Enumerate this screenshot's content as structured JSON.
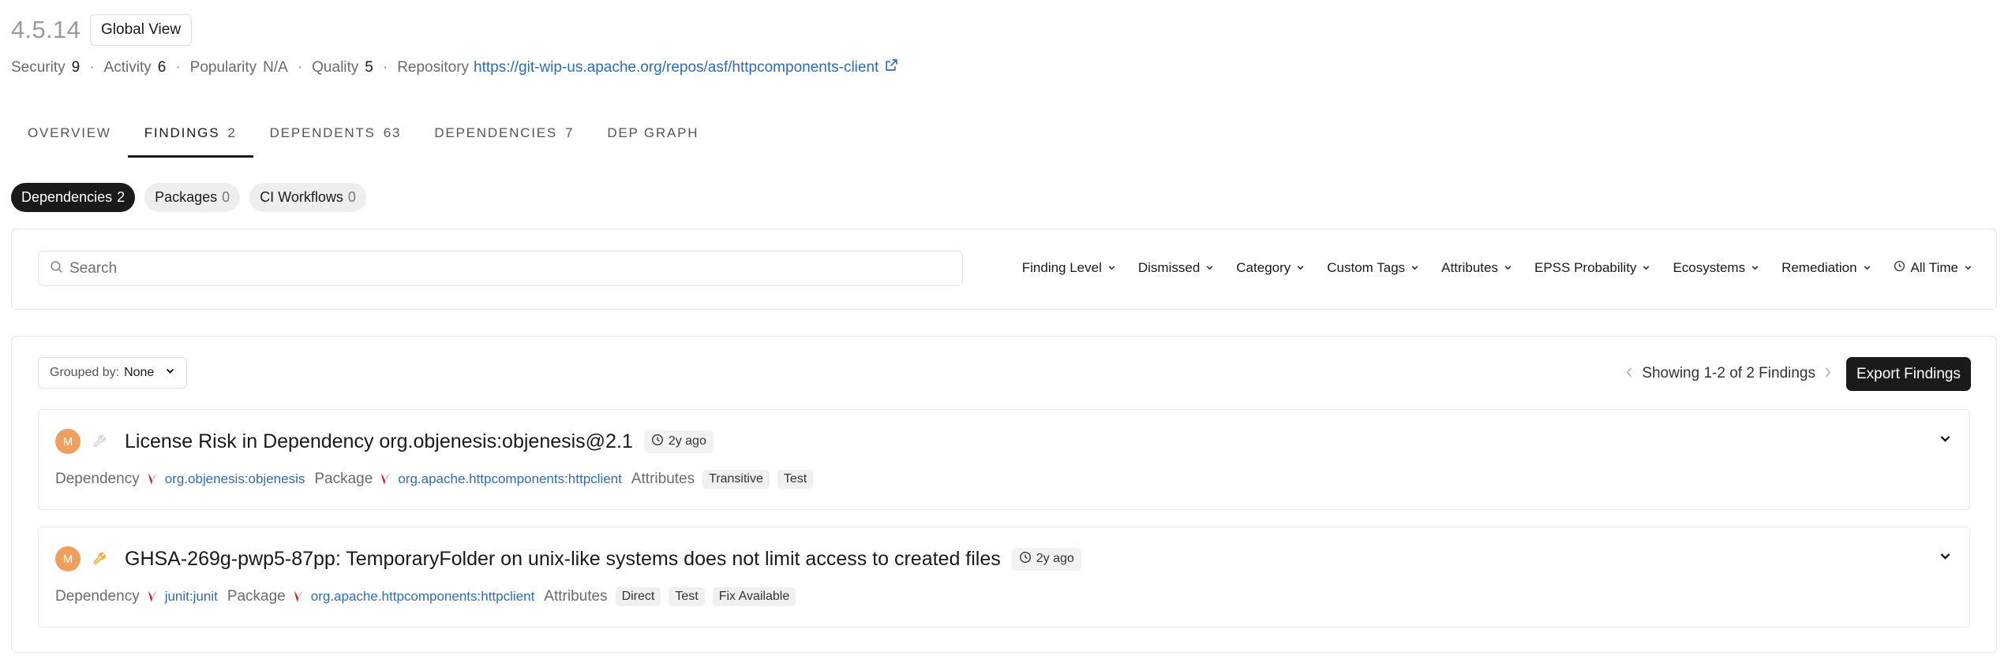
{
  "header": {
    "version": "4.5.14",
    "global_view": "Global View"
  },
  "metrics": {
    "security_label": "Security",
    "security_value": "9",
    "activity_label": "Activity",
    "activity_value": "6",
    "popularity_label": "Popularity",
    "popularity_value": "N/A",
    "quality_label": "Quality",
    "quality_value": "5",
    "repository_label": "Repository",
    "repository_url": "https://git-wip-us.apache.org/repos/asf/httpcomponents-client",
    "separator": "·"
  },
  "tabs": [
    {
      "label": "OVERVIEW",
      "count": ""
    },
    {
      "label": "FINDINGS",
      "count": "2"
    },
    {
      "label": "DEPENDENTS",
      "count": "63"
    },
    {
      "label": "DEPENDENCIES",
      "count": "7"
    },
    {
      "label": "DEP GRAPH",
      "count": ""
    }
  ],
  "pills": [
    {
      "label": "Dependencies",
      "count": "2"
    },
    {
      "label": "Packages",
      "count": "0"
    },
    {
      "label": "CI Workflows",
      "count": "0"
    }
  ],
  "search": {
    "placeholder": "Search"
  },
  "filters": [
    "Finding Level",
    "Dismissed",
    "Category",
    "Custom Tags",
    "Attributes",
    "EPSS Probability",
    "Ecosystems",
    "Remediation",
    "All Time"
  ],
  "list": {
    "grouped_label": "Grouped by:",
    "grouped_value": "None",
    "showing": "Showing 1-2 of 2 Findings",
    "export": "Export Findings"
  },
  "findings": [
    {
      "avatar": "M",
      "title": "License Risk in Dependency org.objenesis:objenesis@2.1",
      "age": "2y ago",
      "dependency_label": "Dependency",
      "dependency": "org.objenesis:objenesis",
      "package_label": "Package",
      "package": "org.apache.httpcomponents:httpclient",
      "attributes_label": "Attributes",
      "attributes": [
        "Transitive",
        "Test"
      ]
    },
    {
      "avatar": "M",
      "title": "GHSA-269g-pwp5-87pp: TemporaryFolder on unix-like systems does not limit access to created files",
      "age": "2y ago",
      "dependency_label": "Dependency",
      "dependency": "junit:junit",
      "package_label": "Package",
      "package": "org.apache.httpcomponents:httpclient",
      "attributes_label": "Attributes",
      "attributes": [
        "Direct",
        "Test",
        "Fix Available"
      ]
    }
  ],
  "colors": {
    "accent_dark": "#1a1a1a",
    "link": "#2f6cb3",
    "avatar": "#f0a05e",
    "maven": "#c4282d",
    "wrench_active": "#e8b03a"
  }
}
